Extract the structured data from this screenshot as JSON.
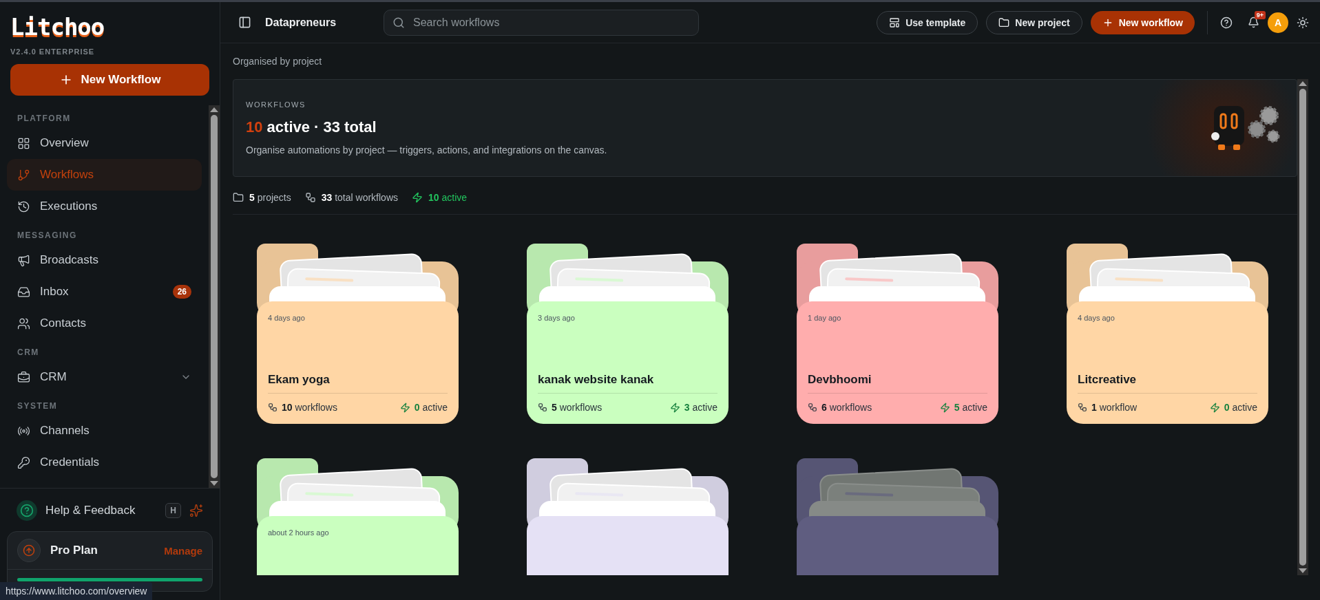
{
  "sidebar": {
    "logo": "Litchoo",
    "version": "V2.4.0 ENTERPRISE",
    "new_button": "New Workflow",
    "sections": [
      {
        "title": "PLATFORM",
        "items": [
          {
            "label": "Overview",
            "selected": false
          },
          {
            "label": "Workflows",
            "selected": true
          },
          {
            "label": "Executions",
            "selected": false
          }
        ]
      },
      {
        "title": "MESSAGING",
        "items": [
          {
            "label": "Broadcasts",
            "selected": false
          },
          {
            "label": "Inbox",
            "selected": false,
            "badge": "26"
          },
          {
            "label": "Contacts",
            "selected": false
          }
        ]
      },
      {
        "title": "CRM",
        "items": [
          {
            "label": "CRM",
            "selected": false,
            "expanded": false
          }
        ]
      },
      {
        "title": "SYSTEM",
        "items": [
          {
            "label": "Channels",
            "selected": false
          },
          {
            "label": "Credentials",
            "selected": false
          }
        ]
      }
    ],
    "help": {
      "label": "Help & Feedback",
      "shortcut": "H"
    },
    "plan": {
      "name": "Pro Plan",
      "action": "Manage",
      "level": 1
    }
  },
  "header": {
    "workspace": "Datapreneurs",
    "search": {
      "placeholder": "Search workflows"
    },
    "buttons": [
      {
        "label": "Use template",
        "kind": "template"
      },
      {
        "label": "New project",
        "kind": "project"
      },
      {
        "label": "New workflow",
        "kind": "primary"
      }
    ],
    "notifications": "9+",
    "avatar": "A"
  },
  "subtitle": "Organised by project",
  "hero": {
    "eyebrow": "WORKFLOWS",
    "active_count": "10",
    "headline": "active · 33 total",
    "description": "Organise automations by project — triggers, actions, and integrations on the canvas."
  },
  "stats": [
    {
      "kind": "projects",
      "value": "5",
      "label": "projects"
    },
    {
      "kind": "workflows",
      "value": "33",
      "label": "total workflows"
    },
    {
      "kind": "active",
      "value": "10",
      "label": "active"
    }
  ],
  "projects": [
    {
      "updated": "4 days ago",
      "name": "Ekam yoga",
      "workflows": "10",
      "workflows_label": "workflows",
      "active": "0",
      "active_label": "active",
      "color": "#ffd6a5",
      "dimmed": false
    },
    {
      "updated": "3 days ago",
      "name": "kanak website kanak",
      "workflows": "5",
      "workflows_label": "workflows",
      "active": "3",
      "active_label": "active",
      "color": "#caffbf",
      "dimmed": false
    },
    {
      "updated": "1 day ago",
      "name": "Devbhoomi",
      "workflows": "6",
      "workflows_label": "workflows",
      "active": "5",
      "active_label": "active",
      "color": "#ffadad",
      "dimmed": false
    },
    {
      "updated": "4 days ago",
      "name": "Litcreative",
      "workflows": "1",
      "workflows_label": "workflow",
      "active": "0",
      "active_label": "active",
      "color": "#ffd6a5",
      "dimmed": false
    },
    {
      "updated": "about 2 hours ago",
      "color": "#caffbf",
      "dimmed": false
    },
    {
      "color": "#e5e1f5",
      "dimmed": false
    },
    {
      "color": "#5f5d80",
      "dimmed": true
    }
  ],
  "status_bar": {
    "url": "https://www.litchoo.com/overview"
  }
}
